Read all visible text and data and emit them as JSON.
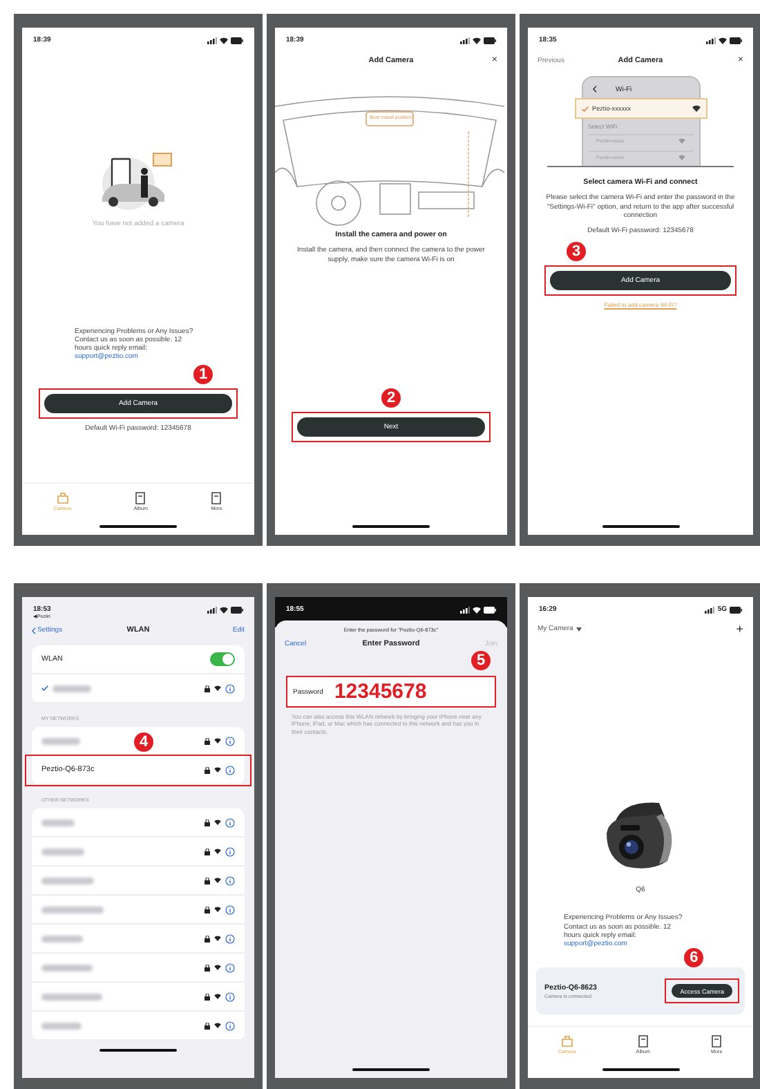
{
  "screens": [
    {
      "kind": "home_empty",
      "step": "1",
      "time": "18:39",
      "empty_text": "You have not added a camera",
      "support_text": "Experiencing Problems or Any Issues? Contact us as soon as possible. 12 hours quick reply email:",
      "email": "support@peztio.com",
      "button": "Add Camera",
      "password_hint": "Default Wi-Fi password: 12345678",
      "tabs": [
        {
          "label": "Camera",
          "selected": true
        },
        {
          "label": "Album",
          "selected": false
        },
        {
          "label": "More",
          "selected": false
        }
      ]
    },
    {
      "kind": "install",
      "step": "2",
      "time": "18:39",
      "title": "Add Camera",
      "close": "×",
      "install_label": "Best install position",
      "heading": "Install the camera and power on",
      "body": "Install the camera, and then connect the camera to the power supply, make sure the camera Wi-Fi is on",
      "button": "Next"
    },
    {
      "kind": "select_wifi",
      "step": "3",
      "time": "18:35",
      "back": "Previous",
      "title": "Add Camera",
      "close": "×",
      "mock": {
        "title": "Wi-Fi",
        "selected_network": "Peztio-xxxxxx",
        "section": "Select WiFi",
        "networks": [
          "Peztio-xxxxx",
          "Peztio-xxxxx"
        ]
      },
      "heading": "Select camera Wi-Fi and connect",
      "body": "Please select the camera Wi-Fi and enter the password in the \"Settings-Wi-Fi\" option, and return to the app after successful connection",
      "password_hint": "Default Wi-Fi password: 12345678",
      "button": "Add Camera",
      "link": "Failed to add camera Wi-Fi?"
    },
    {
      "kind": "wlan_settings",
      "step": "4",
      "time": "18:53",
      "app_back": "◀ Peztio",
      "back": "Settings",
      "title": "WLAN",
      "edit": "Edit",
      "toggle": {
        "label": "WLAN",
        "on": true
      },
      "current": [
        {
          "kind": "blurred",
          "checked": true
        }
      ],
      "my_header": "MY NETWORKS",
      "my_networks": [
        {
          "kind": "blurred",
          "selected": false
        },
        {
          "kind": "named",
          "name": "Peztio-Q6-873c",
          "selected": true
        }
      ],
      "other_header": "OTHER NETWORKS",
      "other_networks": [
        {
          "kind": "blurred"
        },
        {
          "kind": "blurred"
        },
        {
          "kind": "blurred"
        },
        {
          "kind": "blurred"
        },
        {
          "kind": "blurred"
        },
        {
          "kind": "blurred"
        },
        {
          "kind": "blurred"
        },
        {
          "kind": "blurred"
        }
      ]
    },
    {
      "kind": "password",
      "step": "5",
      "time": "18:55",
      "prompt": "Enter the password for \"Peztio-Q6-873c\"",
      "cancel": "Cancel",
      "title": "Enter Password",
      "join": {
        "label": "Join",
        "disabled": true
      },
      "field_label": "Password",
      "value": "12345678",
      "help": "You can also access this WLAN network by bringing your iPhone near any iPhone, iPad, or Mac which has connected to this network and has you in their contacts."
    },
    {
      "kind": "home_camera",
      "step": "6",
      "time": "16:29",
      "network": "5G",
      "menu": "My Camera",
      "add": "+",
      "device_name": "Q6",
      "support_text": "Experiencing Problems or Any Issues? Contact us as soon as possible. 12 hours quick reply email:",
      "email": "support@peztio.com",
      "device": {
        "name": "Peztio-Q6-8623",
        "status": "Camera is connected"
      },
      "button": "Access Camera",
      "tabs": [
        {
          "label": "Camera",
          "selected": true
        },
        {
          "label": "Album",
          "selected": false
        },
        {
          "label": "More",
          "selected": false
        }
      ]
    }
  ]
}
